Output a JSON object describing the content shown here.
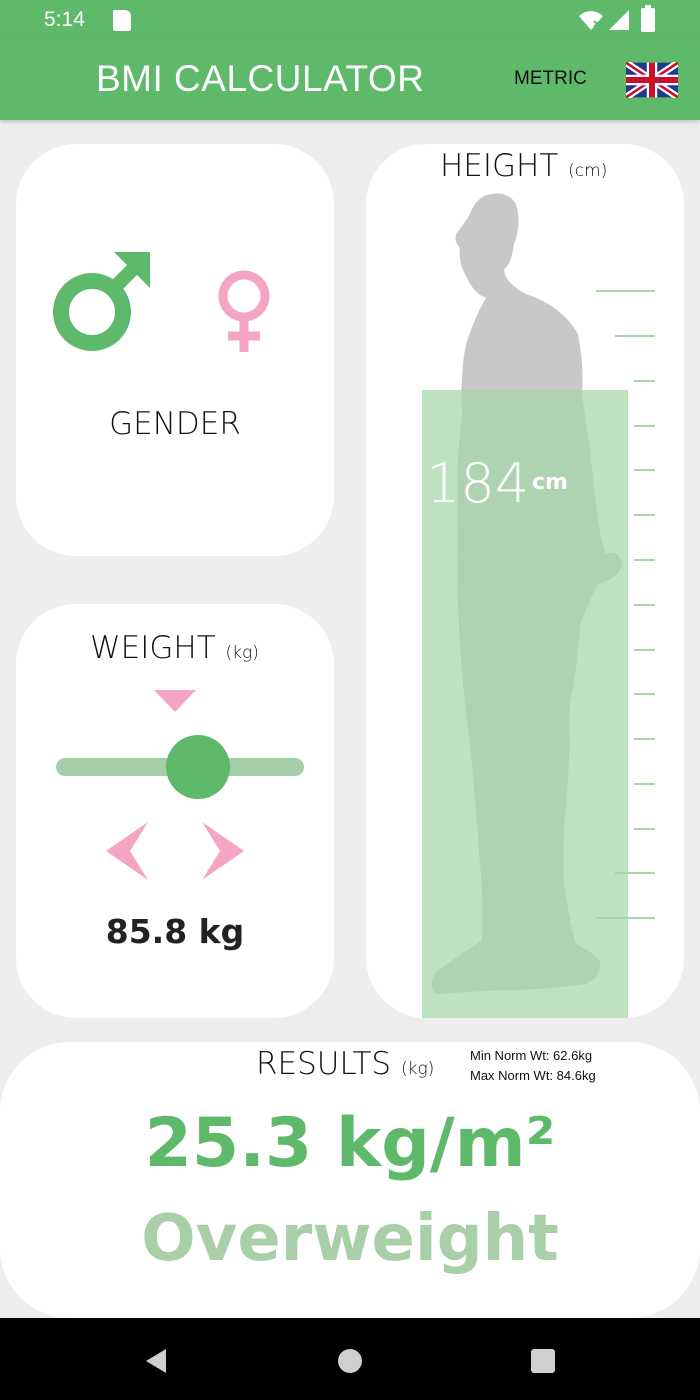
{
  "status_bar": {
    "time": "5:14",
    "icons": [
      "sd-card-icon",
      "wifi-icon",
      "signal-icon",
      "battery-icon"
    ]
  },
  "app_bar": {
    "title": "BMI CALCULATOR",
    "unit_toggle": "METRIC",
    "language_icon": "uk-flag-icon"
  },
  "colors": {
    "accent": "#5fb96a",
    "female": "#f5a5c4",
    "height_fill": "#a5d6a7",
    "category": "#a8cfa8"
  },
  "gender": {
    "label": "GENDER",
    "selected": "male"
  },
  "weight": {
    "title": "WEIGHT",
    "unit": "(kg)",
    "value_text": "85.8 kg"
  },
  "height": {
    "title": "HEIGHT",
    "unit": "(cm)",
    "value": "184",
    "value_unit": "cm"
  },
  "results": {
    "title": "RESULTS",
    "unit": "(kg)",
    "min_norm": "Min Norm Wt: 62.6kg",
    "max_norm": "Max Norm Wt: 84.6kg",
    "bmi": "25.3 kg/m²",
    "category": "Overweight"
  },
  "nav_bar": {
    "icons": [
      "back-icon",
      "home-icon",
      "recents-icon"
    ]
  }
}
